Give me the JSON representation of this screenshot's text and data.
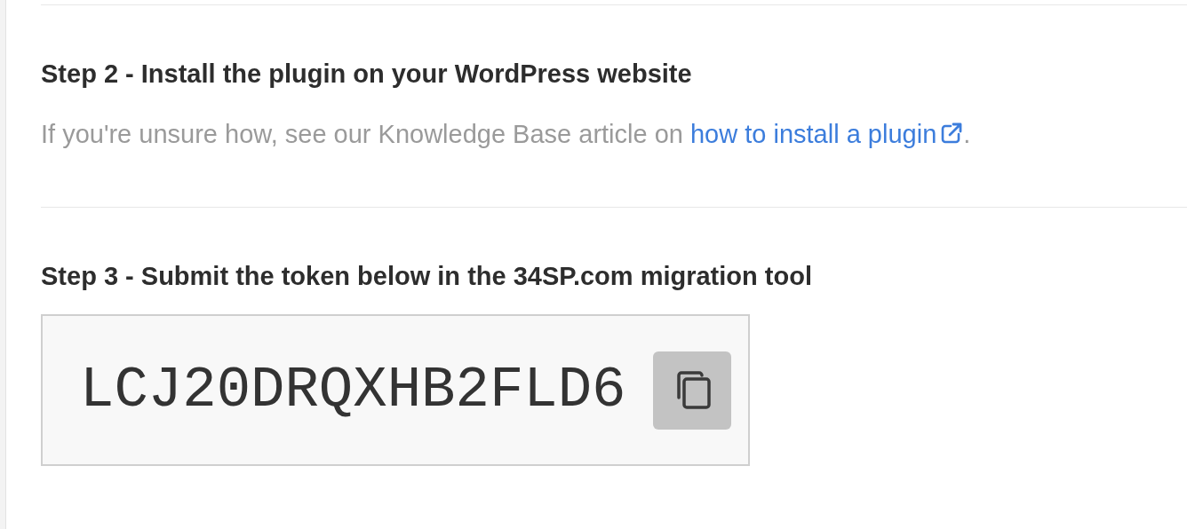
{
  "steps": [
    {
      "kind": "info",
      "title": "Step 2 - Install the plugin on your WordPress website",
      "text": "If you're unsure how, see our Knowledge Base article on ",
      "link": "how to install a plugin",
      "text_after": "."
    },
    {
      "kind": "token",
      "title": "Step 3 - Submit the token below in the 34SP.com migration tool",
      "token": "LCJ20DRQXHB2FLD6"
    }
  ]
}
